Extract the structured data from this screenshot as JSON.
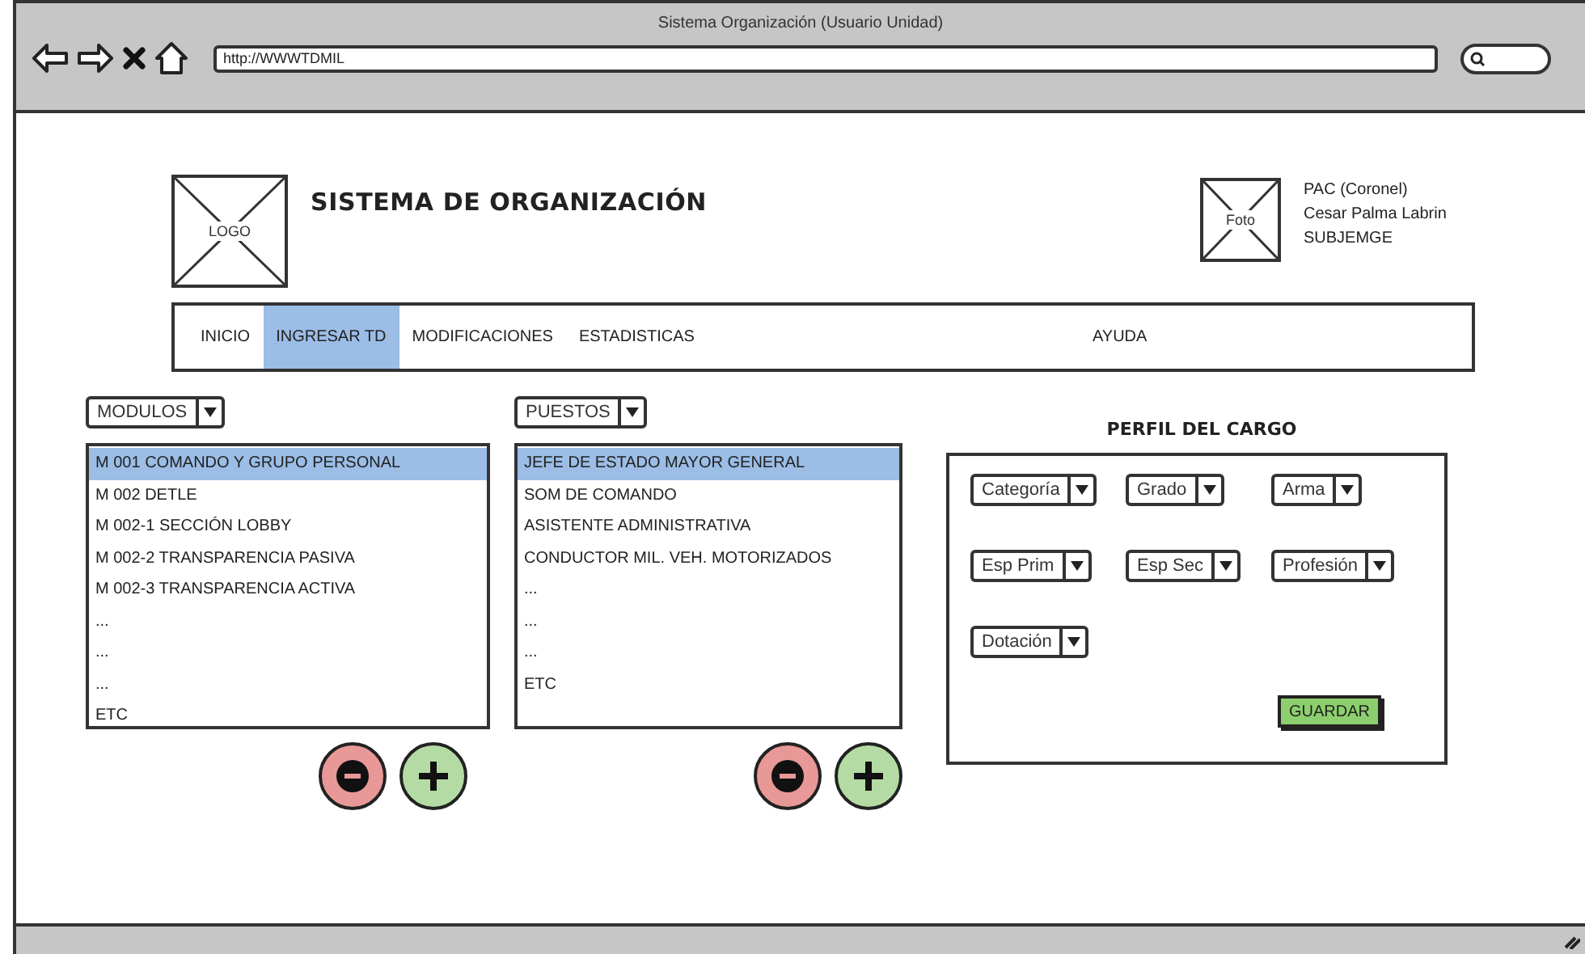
{
  "window": {
    "title": "Sistema Organización (Usuario Unidad)"
  },
  "address_bar": {
    "value": "http://WWWTDMIL"
  },
  "header": {
    "logo": "LOGO",
    "title": "SISTEMA DE ORGANIZACIÓN",
    "photo": "Foto",
    "user_lines": [
      "PAC (Coronel)",
      "Cesar Palma Labrin",
      "SUBJEMGE"
    ]
  },
  "nav": {
    "tabs": [
      {
        "label": "INICIO",
        "selected": false
      },
      {
        "label": "INGRESAR TD",
        "selected": true
      },
      {
        "label": "MODIFICACIONES",
        "selected": false
      },
      {
        "label": "ESTADISTICAS",
        "selected": false
      }
    ],
    "help": {
      "label": "AYUDA",
      "selected": false
    }
  },
  "modules": {
    "dropdown": "MODULOS",
    "items": [
      {
        "label": "M 001 COMANDO Y GRUPO PERSONAL",
        "selected": true
      },
      {
        "label": "M 002 DETLE",
        "selected": false
      },
      {
        "label": "M 002-1 SECCIÓN LOBBY",
        "selected": false
      },
      {
        "label": "M 002-2 TRANSPARENCIA PASIVA",
        "selected": false
      },
      {
        "label": "M 002-3 TRANSPARENCIA ACTIVA",
        "selected": false
      },
      {
        "label": "...",
        "selected": false
      },
      {
        "label": "...",
        "selected": false
      },
      {
        "label": "...",
        "selected": false
      },
      {
        "label": "ETC",
        "selected": false
      }
    ],
    "buttons": [
      {
        "kind": "remove"
      },
      {
        "kind": "add"
      }
    ]
  },
  "positions": {
    "dropdown": "PUESTOS",
    "items": [
      {
        "label": "JEFE DE ESTADO MAYOR GENERAL",
        "selected": true
      },
      {
        "label": "SOM DE COMANDO",
        "selected": false
      },
      {
        "label": "ASISTENTE ADMINISTRATIVA",
        "selected": false
      },
      {
        "label": "CONDUCTOR MIL. VEH. MOTORIZADOS",
        "selected": false
      },
      {
        "label": "...",
        "selected": false
      },
      {
        "label": "...",
        "selected": false
      },
      {
        "label": "...",
        "selected": false
      },
      {
        "label": "ETC",
        "selected": false
      }
    ],
    "buttons": [
      {
        "kind": "remove"
      },
      {
        "kind": "add"
      }
    ]
  },
  "profile": {
    "title": "PERFIL DEL CARGO",
    "dropdowns": [
      "Categoría",
      "Grado",
      "Arma",
      "Esp Prim",
      "Esp Sec",
      "Profesión",
      "Dotación"
    ],
    "save_button": "GUARDAR"
  }
}
